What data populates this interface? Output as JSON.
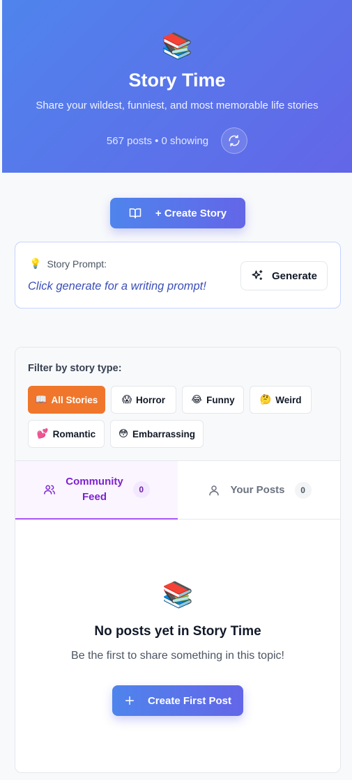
{
  "hero": {
    "emoji": "📚",
    "title": "Story Time",
    "subtitle": "Share your wildest, funniest, and most memorable life stories",
    "counts": "567 posts • 0 showing",
    "refresh_icon": "refresh-icon"
  },
  "create_button": {
    "icon": "book-open-icon",
    "label": "+ Create Story"
  },
  "prompt": {
    "emoji": "💡",
    "label": "Story Prompt:",
    "text": "Click generate for a writing prompt!",
    "generate_icon": "sparkles-icon",
    "generate_label": "Generate"
  },
  "filters": {
    "title": "Filter by story type:",
    "chips": [
      {
        "emoji": "📖",
        "label": "All Stories",
        "active": true
      },
      {
        "emoji": "😱",
        "label": "Horror",
        "active": false
      },
      {
        "emoji": "😂",
        "label": "Funny",
        "active": false
      },
      {
        "emoji": "🤔",
        "label": "Weird",
        "active": false
      },
      {
        "emoji": "💕",
        "label": "Romantic",
        "active": false
      },
      {
        "emoji": "😳",
        "label": "Embarrassing",
        "active": false
      }
    ]
  },
  "tabs": [
    {
      "icon": "users-icon",
      "label_line1": "Community",
      "label_line2": "Feed",
      "count": "0",
      "active": true
    },
    {
      "icon": "user-icon",
      "label": "Your Posts",
      "count": "0",
      "active": false
    }
  ],
  "empty_state": {
    "emoji": "📚",
    "title": "No posts yet in Story Time",
    "subtitle": "Be the first to share something in this topic!",
    "button_icon": "plus-icon",
    "button_label": "Create First Post"
  },
  "colors": {
    "brand_gradient_start": "#4f84ec",
    "brand_gradient_end": "#6366e8",
    "active_chip": "#f0762b",
    "active_tab": "#7e22ce"
  }
}
